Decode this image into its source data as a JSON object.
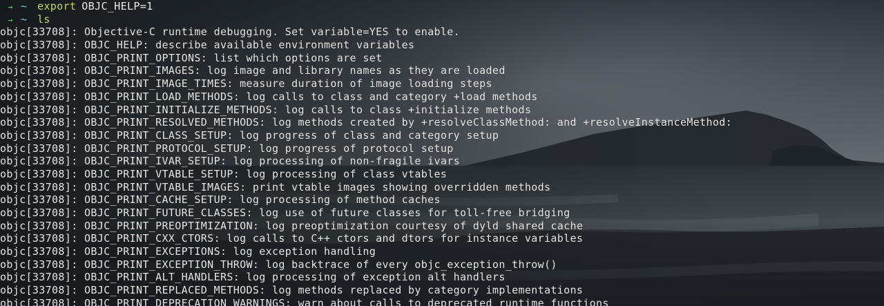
{
  "terminal": {
    "prompts": [
      {
        "arrow": "→",
        "cwd": "~",
        "command": "export",
        "args": "OBJC_HELP=1"
      },
      {
        "arrow": "→",
        "cwd": "~",
        "command": "ls",
        "args": ""
      }
    ],
    "output": [
      "objc[33708]: Objective-C runtime debugging. Set variable=YES to enable.",
      "objc[33708]: OBJC_HELP: describe available environment variables",
      "objc[33708]: OBJC_PRINT_OPTIONS: list which options are set",
      "objc[33708]: OBJC_PRINT_IMAGES: log image and library names as they are loaded",
      "objc[33708]: OBJC_PRINT_IMAGE_TIMES: measure duration of image loading steps",
      "objc[33708]: OBJC_PRINT_LOAD_METHODS: log calls to class and category +load methods",
      "objc[33708]: OBJC_PRINT_INITIALIZE_METHODS: log calls to class +initialize methods",
      "objc[33708]: OBJC_PRINT_RESOLVED_METHODS: log methods created by +resolveClassMethod: and +resolveInstanceMethod:",
      "objc[33708]: OBJC_PRINT_CLASS_SETUP: log progress of class and category setup",
      "objc[33708]: OBJC_PRINT_PROTOCOL_SETUP: log progress of protocol setup",
      "objc[33708]: OBJC_PRINT_IVAR_SETUP: log processing of non-fragile ivars",
      "objc[33708]: OBJC_PRINT_VTABLE_SETUP: log processing of class vtables",
      "objc[33708]: OBJC_PRINT_VTABLE_IMAGES: print vtable images showing overridden methods",
      "objc[33708]: OBJC_PRINT_CACHE_SETUP: log processing of method caches",
      "objc[33708]: OBJC_PRINT_FUTURE_CLASSES: log use of future classes for toll-free bridging",
      "objc[33708]: OBJC_PRINT_PREOPTIMIZATION: log preoptimization courtesy of dyld shared cache",
      "objc[33708]: OBJC_PRINT_CXX_CTORS: log calls to C++ ctors and dtors for instance variables",
      "objc[33708]: OBJC_PRINT_EXCEPTIONS: log exception handling",
      "objc[33708]: OBJC_PRINT_EXCEPTION_THROW: log backtrace of every objc_exception_throw()",
      "objc[33708]: OBJC_PRINT_ALT_HANDLERS: log processing of exception alt handlers",
      "objc[33708]: OBJC_PRINT_REPLACED_METHODS: log methods replaced by category implementations",
      "objc[33708]: OBJC_PRINT_DEPRECATION_WARNINGS: warn about calls to deprecated runtime functions"
    ]
  },
  "colors": {
    "prompt_arrow": "#6fd06d",
    "prompt_cwd": "#78d4d6",
    "command": "#c7d95c",
    "output_text": "#e7e7e7"
  }
}
